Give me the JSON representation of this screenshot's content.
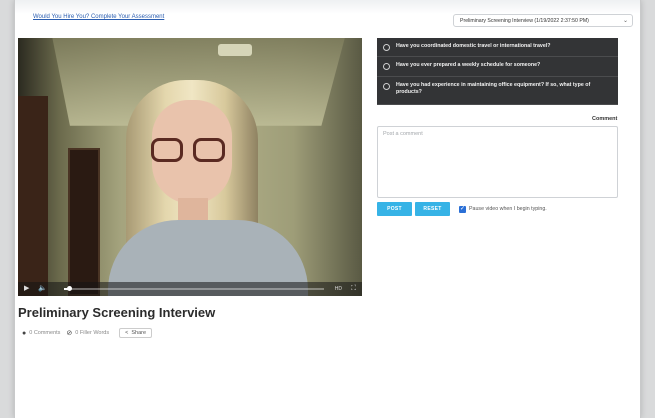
{
  "header": {
    "survey_link": "Would You Hire You? Complete Your Assessment",
    "interview_select": "Preliminary Screening Interview (1/19/2022 2:37:50 PM)"
  },
  "video": {
    "title": "Preliminary Screening Interview",
    "progress_fraction": 0.02,
    "controls": {
      "quality_label": "HD"
    }
  },
  "meta": {
    "comments": "0 Comments",
    "filler_words": "0 Filler Words",
    "share": "Share"
  },
  "questions": [
    "Have you coordinated domestic travel or international travel?",
    "Have you ever prepared a weekly schedule for someone?",
    "Have you had experience in maintaining office equipment? If so, what type of products?"
  ],
  "comment": {
    "label": "Comment",
    "placeholder": "Post a comment",
    "post_label": "POST",
    "reset_label": "RESET",
    "pause_label": "Pause video when I begin typing.",
    "pause_checked": true
  },
  "colors": {
    "accent": "#36b3e6",
    "question_bg": "#333436",
    "link": "#2a5db0"
  }
}
